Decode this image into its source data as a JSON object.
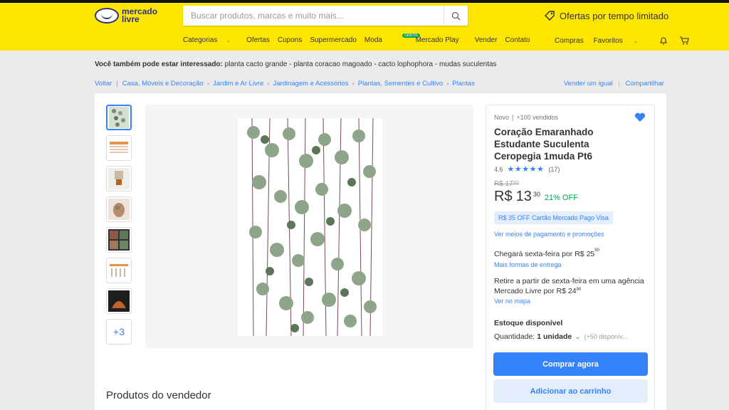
{
  "header": {
    "logo_line1": "mercado",
    "logo_line2": "livre",
    "search_placeholder": "Buscar produtos, marcas e muito mais...",
    "promo_label": "Ofertas por tempo limitado",
    "nav": [
      {
        "label": "Categorias"
      },
      {
        "label": "Ofertas"
      },
      {
        "label": "Cupons"
      },
      {
        "label": "Supermercado"
      },
      {
        "label": "Moda"
      },
      {
        "label": "Mercado Play",
        "badge": "GRÁTIS"
      },
      {
        "label": "Vender"
      },
      {
        "label": "Contato"
      }
    ],
    "account": {
      "purchases": "Compras",
      "favorites": "Favoritos"
    }
  },
  "interest": {
    "label": "Você também pode estar interessado:",
    "items": "planta cacto grande - planta coracao magoado - cacto lophophora - mudas suculentas"
  },
  "breadcrumb": {
    "back": "Voltar",
    "items": [
      "Casa, Móveis e Decoração",
      "Jardim e Ar Livre",
      "Jardinagem e Acessórios",
      "Plantas, Sementes e Cultivo",
      "Plantas"
    ],
    "sell_similar": "Vender um igual",
    "share": "Compartilhar"
  },
  "gallery": {
    "more_count": "+3"
  },
  "product": {
    "condition": "Novo",
    "sold": "+100 vendidos",
    "title": "Coração Emaranhado Estudante Suculenta Ceropegia 1muda Pt6",
    "rating": "4.6",
    "reviews": "(17)",
    "old_price": "R$ 17⁹⁰",
    "currency": "R$",
    "price_int": "13",
    "price_cents": "30",
    "discount": "21% OFF",
    "card_promo": "R$ 35 OFF Cartão Mercado Pago Visa",
    "payment_link": "Ver meios de pagamento e promoções",
    "shipping_text": "Chegará sexta-feira por R$ 25",
    "shipping_cents": "90",
    "shipping_link": "Mais formas de entrega",
    "pickup_text": "Retire a partir de sexta-feira em uma agência Mercado Livre por R$ 24",
    "pickup_cents": "90",
    "map_link": "Ver no mapa",
    "stock": "Estoque disponível",
    "quantity_label": "Quantidade:",
    "quantity_value": "1 unidade",
    "quantity_available": "(+50 disponív..."
  },
  "actions": {
    "buy": "Comprar agora",
    "cart": "Adicionar ao carrinho"
  },
  "vendor_products_title": "Produtos do vendedor",
  "colors": {
    "brand_yellow": "#ffe600",
    "primary_blue": "#3483fa",
    "discount_green": "#00a650"
  }
}
